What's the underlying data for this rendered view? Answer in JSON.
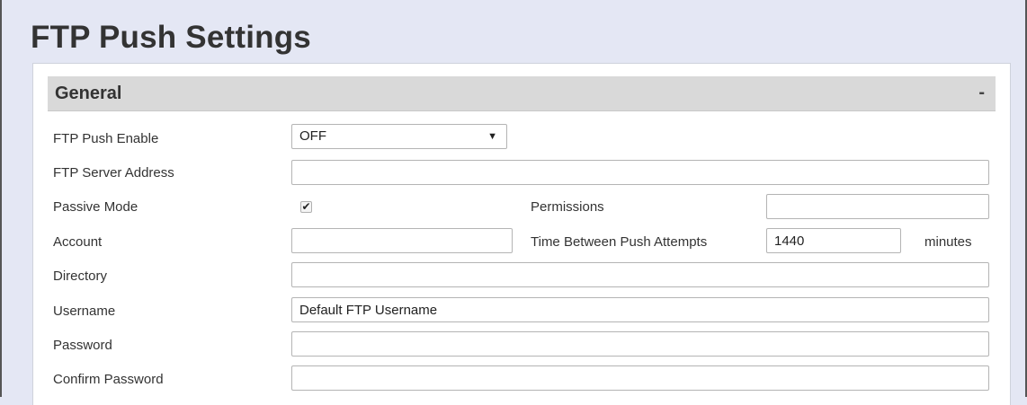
{
  "page": {
    "title": "FTP Push Settings"
  },
  "section": {
    "title": "General",
    "toggle": "-"
  },
  "form": {
    "ftp_push_enable": {
      "label": "FTP Push Enable",
      "value": "OFF"
    },
    "ftp_server_address": {
      "label": "FTP Server Address",
      "value": ""
    },
    "passive_mode": {
      "label": "Passive Mode",
      "checked": true
    },
    "permissions": {
      "label": "Permissions",
      "value": ""
    },
    "account": {
      "label": "Account",
      "value": ""
    },
    "time_between_push": {
      "label": "Time Between Push Attempts",
      "value": "1440",
      "unit": "minutes"
    },
    "directory": {
      "label": "Directory",
      "value": ""
    },
    "username": {
      "label": "Username",
      "value": "Default FTP Username"
    },
    "password": {
      "label": "Password",
      "value": ""
    },
    "confirm_password": {
      "label": "Confirm Password",
      "value": ""
    }
  },
  "icons": {
    "select_caret": "caret-down-icon",
    "checkmark": "checkmark-icon"
  }
}
